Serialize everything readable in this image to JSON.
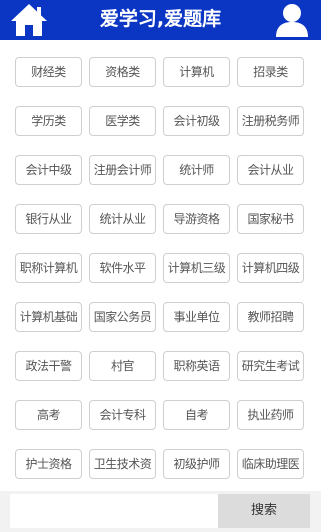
{
  "header": {
    "title": "爱学习,爱题库",
    "home_icon": "home-icon",
    "user_icon": "user-icon"
  },
  "categories": [
    "财经类",
    "资格类",
    "计算机",
    "招录类",
    "学历类",
    "医学类",
    "会计初级",
    "注册税务师",
    "会计中级",
    "注册会计师",
    "统计师",
    "会计从业",
    "银行从业",
    "统计从业",
    "导游资格",
    "国家秘书",
    "职称计算机",
    "软件水平",
    "计算机三级",
    "计算机四级",
    "计算机基础",
    "国家公务员",
    "事业单位",
    "教师招聘",
    "政法干警",
    "村官",
    "职称英语",
    "研究生考试",
    "高考",
    "会计专科",
    "自考",
    "执业药师",
    "护士资格",
    "卫生技术资",
    "初级护师",
    "临床助理医"
  ],
  "search": {
    "placeholder": "",
    "button_label": "搜索"
  },
  "colors": {
    "header_bg": "#0b36c4",
    "button_border": "#cfcfcf",
    "search_bar_bg": "#f2f2f2"
  }
}
